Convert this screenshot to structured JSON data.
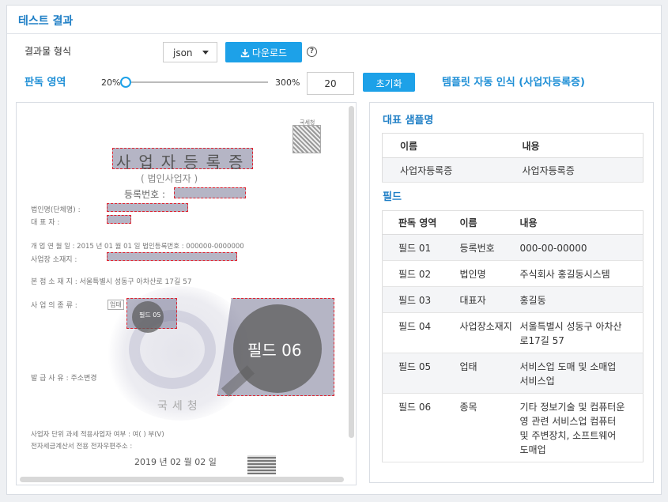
{
  "panel": {
    "title": "테스트 결과"
  },
  "format": {
    "label": "결과물 형식",
    "selected": "json",
    "download_label": "다운로드"
  },
  "region": {
    "label": "판독 영역",
    "min_label": "20%",
    "max_label": "300%",
    "value": "20",
    "reset_label": "초기화",
    "auto_template": "템플릿 자동 인식 (사업자등록증)"
  },
  "document": {
    "title": "사업자등록증",
    "subtitle": "( 법인사업자 )",
    "reg_no_label": "등록번호 :",
    "rows": [
      "법인명(단체명) :",
      "대   표   자 :",
      "개 업 연 월 일 :  2015 년 01 월 01 일       법인등록번호 :  000000-0000000",
      "사업장 소재지 :",
      "본 점 소 재 지 :  서울특별시 성동구 아차산로 17길 57",
      "사  업  의  종  류 :",
      "발  급  사  유 :  주소변경",
      "사업자 단위 과세 적용사업자 여부 :  여(   ) 부(V)",
      "전자세금계산서 전용 전자우편주소 :"
    ],
    "date": "2019 년  02 월  02 일",
    "seal_text": "국세청",
    "qr_text": "국세청",
    "small_badge": "업태",
    "field05_label": "필드 05",
    "field06_label": "필드 06"
  },
  "representative": {
    "title": "대표 샘플명",
    "headers": [
      "이름",
      "내용"
    ],
    "rows": [
      [
        "사업자등록증",
        "사업자등록증"
      ]
    ]
  },
  "fields": {
    "title": "필드",
    "headers": [
      "판독 영역",
      "이름",
      "내용"
    ],
    "rows": [
      [
        "필드 01",
        "등록번호",
        "000-00-00000"
      ],
      [
        "필드 02",
        "법인명",
        "주식회사 홍길동시스템"
      ],
      [
        "필드 03",
        "대표자",
        "홍길동"
      ],
      [
        "필드 04",
        "사업장소재지",
        "서울특별시 성동구 아차산로17길 57"
      ],
      [
        "필드 05",
        "업태",
        "서비스업 도매 및 소매업 서비스업"
      ],
      [
        "필드 06",
        "종목",
        "기타 정보기술 및 컴퓨터운영 관련 서비스업 컴퓨터 및 주변장치, 소프트웨어 도매업"
      ]
    ]
  }
}
